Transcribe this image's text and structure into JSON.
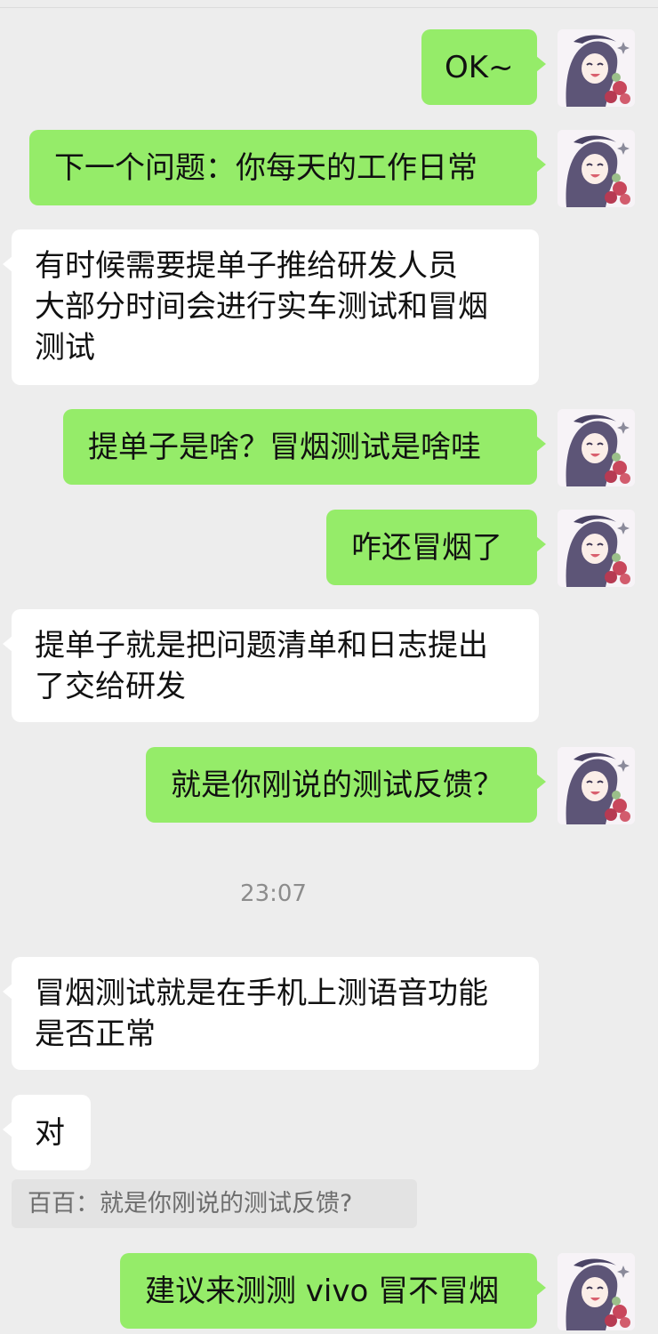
{
  "messages": [
    {
      "id": "m1",
      "sender": "me",
      "text": "OK~"
    },
    {
      "id": "m2",
      "sender": "me",
      "text": "下一个问题：你每天的工作日常"
    },
    {
      "id": "m3",
      "sender": "other",
      "lines": [
        "有时候需要提单子推给研发人员",
        "大部分时间会进行实车测试和冒烟",
        "测试"
      ]
    },
    {
      "id": "m4",
      "sender": "me",
      "text": "提单子是啥？冒烟测试是啥哇"
    },
    {
      "id": "m5",
      "sender": "me",
      "text": "咋还冒烟了"
    },
    {
      "id": "m6",
      "sender": "other",
      "lines": [
        "提单子就是把问题清单和日志提出",
        "了交给研发"
      ]
    },
    {
      "id": "m7",
      "sender": "me",
      "text": "就是你刚说的测试反馈？"
    },
    {
      "id": "m8",
      "sender": "other",
      "lines": [
        "冒烟测试就是在手机上测语音功能",
        "是否正常"
      ]
    },
    {
      "id": "m9",
      "sender": "other",
      "text": "对"
    },
    {
      "id": "m10",
      "sender": "me",
      "text": "建议来测测 vivo 冒不冒烟"
    }
  ],
  "timestamp": "23:07",
  "quote": {
    "author": "百百",
    "separator": "：",
    "text": "就是你刚说的测试反馈?"
  },
  "colors": {
    "background": "#ededed",
    "outgoing_bubble": "#95ec69",
    "incoming_bubble": "#ffffff",
    "quote_background": "#e3e3e3"
  },
  "icons": {
    "avatar": "anime-girl-avatar"
  }
}
